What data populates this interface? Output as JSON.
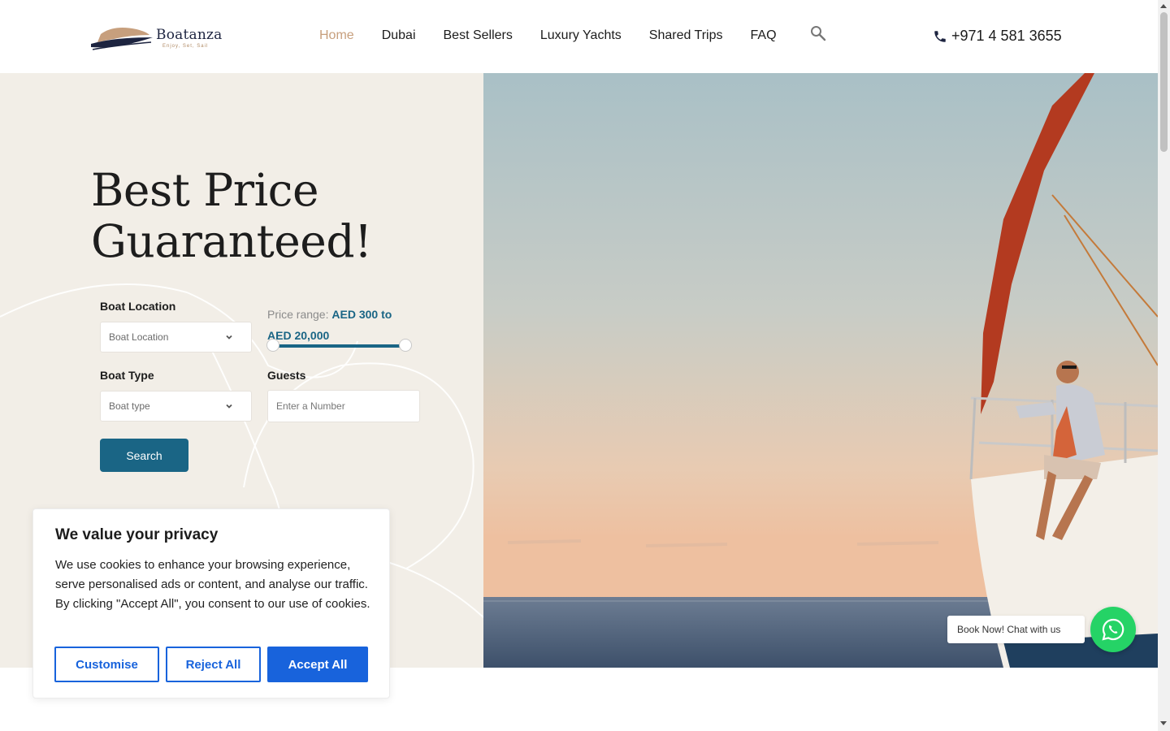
{
  "header": {
    "logo_name": "Boatanza",
    "logo_tagline": "Enjoy, Set, Sail",
    "nav": [
      {
        "label": "Home",
        "active": true
      },
      {
        "label": "Dubai",
        "active": false
      },
      {
        "label": "Best Sellers",
        "active": false
      },
      {
        "label": "Luxury Yachts",
        "active": false
      },
      {
        "label": "Shared Trips",
        "active": false
      },
      {
        "label": "FAQ",
        "active": false
      }
    ],
    "phone": "+971 4 581 3655"
  },
  "hero": {
    "title_line1": "Best Price",
    "title_line2": "Guaranteed!",
    "form": {
      "location_label": "Boat Location",
      "location_value": "Boat Location",
      "boat_type_label": "Boat Type",
      "boat_type_value": "Boat type",
      "price_label": "Price range:",
      "price_value": "AED 300 to AED 20,000",
      "price_min": 300,
      "price_max": 20000,
      "guests_label": "Guests",
      "guests_placeholder": "Enter a Number",
      "search_label": "Search"
    }
  },
  "cookie": {
    "title": "We value your privacy",
    "text": "We use cookies to enhance your browsing experience, serve personalised ads or content, and analyse our traffic. By clicking \"Accept All\", you consent to our use of cookies.",
    "customise": "Customise",
    "reject": "Reject All",
    "accept": "Accept All"
  },
  "whatsapp": {
    "label": "Book Now! Chat with us"
  },
  "colors": {
    "accent": "#1a6585",
    "nav_active": "#c79f7d",
    "cookie_blue": "#1863dc",
    "whatsapp_green": "#25d366",
    "hero_bg": "#f2eee7"
  }
}
